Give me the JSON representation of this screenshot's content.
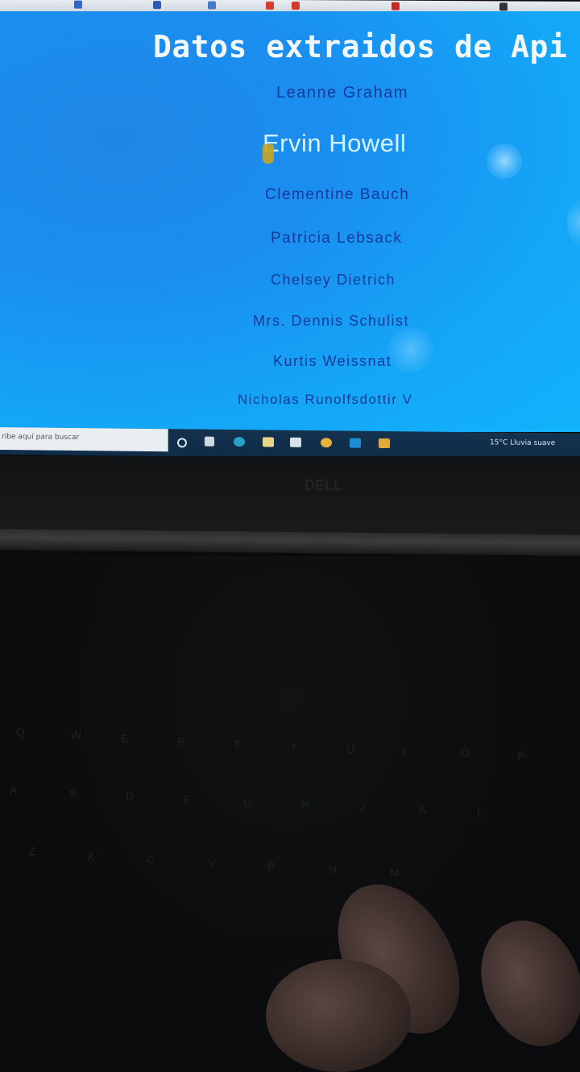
{
  "page": {
    "title": "Datos extraidos de Api"
  },
  "users": [
    "Leanne Graham",
    "Ervin Howell",
    "Clementine Bauch",
    "Patricia Lebsack",
    "Chelsey Dietrich",
    "Mrs. Dennis Schulist",
    "Kurtis Weissnat",
    "Nicholas Runolfsdottir V"
  ],
  "taskbar": {
    "search_placeholder": "ribe aquí para buscar",
    "weather": "15°C  Lluvia suave"
  },
  "keyboard": {
    "keys": [
      "Q",
      "W",
      "E",
      "R",
      "T",
      "Y",
      "U",
      "I",
      "O",
      "P",
      "A",
      "S",
      "D",
      "F",
      "G",
      "H",
      "J",
      "K",
      "L",
      "Z",
      "X",
      "C",
      "V",
      "B",
      "N",
      "M"
    ]
  },
  "colors": {
    "screen_bg": "#1a8ff0",
    "title": "#f2f7fb",
    "user_text": "#173a9a",
    "hovered_user_text": "#d3f3ff"
  }
}
